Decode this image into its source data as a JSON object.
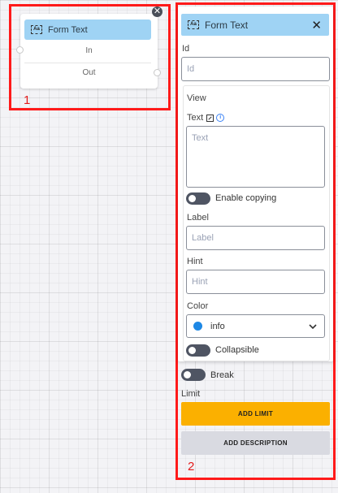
{
  "node": {
    "title": "Form Text",
    "icon_text": "Aa",
    "close_glyph": "✕",
    "input_port": "In",
    "output_port": "Out"
  },
  "panel": {
    "title": "Form Text",
    "icon_text": "Aa",
    "close_glyph": "✕",
    "id_label": "Id",
    "id_placeholder": "Id",
    "view_label": "View",
    "text_label": "Text",
    "text_placeholder": "Text",
    "enable_copying_label": "Enable copying",
    "label_label": "Label",
    "label_placeholder": "Label",
    "hint_label": "Hint",
    "hint_placeholder": "Hint",
    "color_label": "Color",
    "color_value": "info",
    "color_value_hex": "#1e88e5",
    "collapsible_label": "Collapsible",
    "break_label": "Break",
    "limit_label": "Limit",
    "add_limit_label": "ADD LIMIT",
    "add_description_label": "ADD DESCRIPTION"
  },
  "annotations": {
    "box1_label": "1",
    "box2_label": "2",
    "outline_color": "#ff1a1a"
  },
  "colors": {
    "header_bg": "#9fd3f4",
    "primary_button": "#fbb000",
    "secondary_button": "#d9dae1",
    "toggle_off": "#4f5563"
  }
}
